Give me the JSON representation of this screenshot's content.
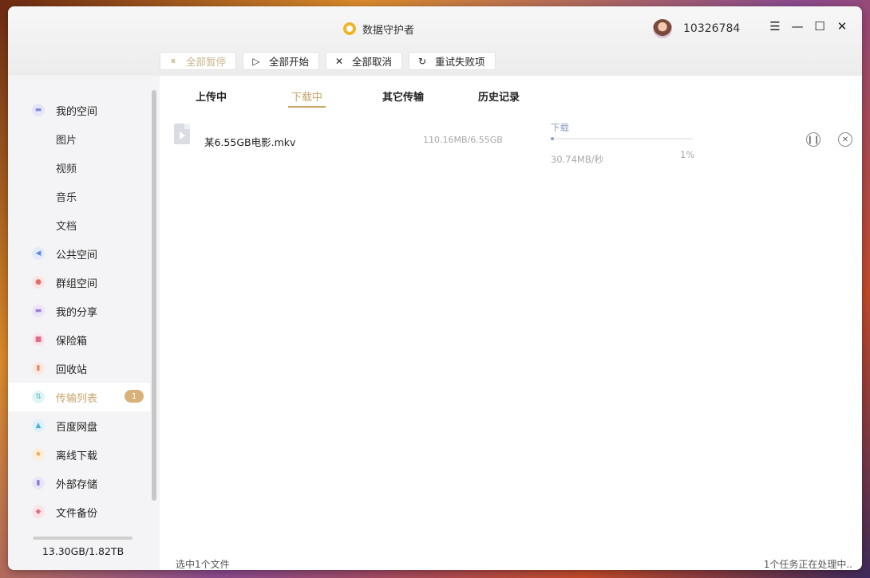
{
  "window": {
    "title": "数据守护者"
  },
  "user": {
    "id": "10326784"
  },
  "window_controls": [
    "menu-icon",
    "minimize-icon",
    "maximize-icon",
    "close-icon"
  ],
  "toolbar": {
    "pause_all": "全部暂停",
    "start_all": "全部开始",
    "cancel_all": "全部取消",
    "retry_failed": "重试失败项"
  },
  "sidebar": {
    "items": [
      {
        "label": "我的空间",
        "icon": "my-space-icon",
        "color": "#7a8fd6"
      },
      {
        "label": "图片"
      },
      {
        "label": "视频"
      },
      {
        "label": "音乐"
      },
      {
        "label": "文档"
      },
      {
        "label": "公共空间",
        "icon": "public-space-icon",
        "color": "#5b8fe0"
      },
      {
        "label": "群组空间",
        "icon": "group-space-icon",
        "color": "#e07070"
      },
      {
        "label": "我的分享",
        "icon": "share-icon",
        "color": "#9b7bd6"
      },
      {
        "label": "保险箱",
        "icon": "safe-icon",
        "color": "#e06a8a"
      },
      {
        "label": "回收站",
        "icon": "recycle-bin-icon",
        "color": "#e08a6a"
      },
      {
        "label": "传输列表",
        "icon": "transfer-icon",
        "color": "#5bc0c0",
        "badge": "1"
      },
      {
        "label": "百度网盘",
        "icon": "baidu-netdisk-icon",
        "color": "#4ab0d8"
      },
      {
        "label": "离线下载",
        "icon": "offline-download-icon",
        "color": "#e8a040"
      },
      {
        "label": "外部存储",
        "icon": "external-storage-icon",
        "color": "#8a7ad6"
      },
      {
        "label": "文件备份",
        "icon": "backup-icon",
        "color": "#e07080"
      }
    ],
    "storage": {
      "text": "13.30GB/1.82TB",
      "fraction": 0.007
    }
  },
  "tabs": [
    "上传中",
    "下载中",
    "其它传输",
    "历史记录"
  ],
  "active_tab": "下载中",
  "transfer": {
    "filename": "某6.55GB电影.mkv",
    "size": "110.16MB/6.55GB",
    "status": "下载",
    "speed": "30.74MB/秒",
    "percent": "1%",
    "progress": 0.01
  },
  "footer": {
    "left": "选中1个文件",
    "right": "1个任务正在处理中.."
  },
  "colors": {
    "accent": "#c8a46c",
    "progress": "#8aa0c8"
  }
}
